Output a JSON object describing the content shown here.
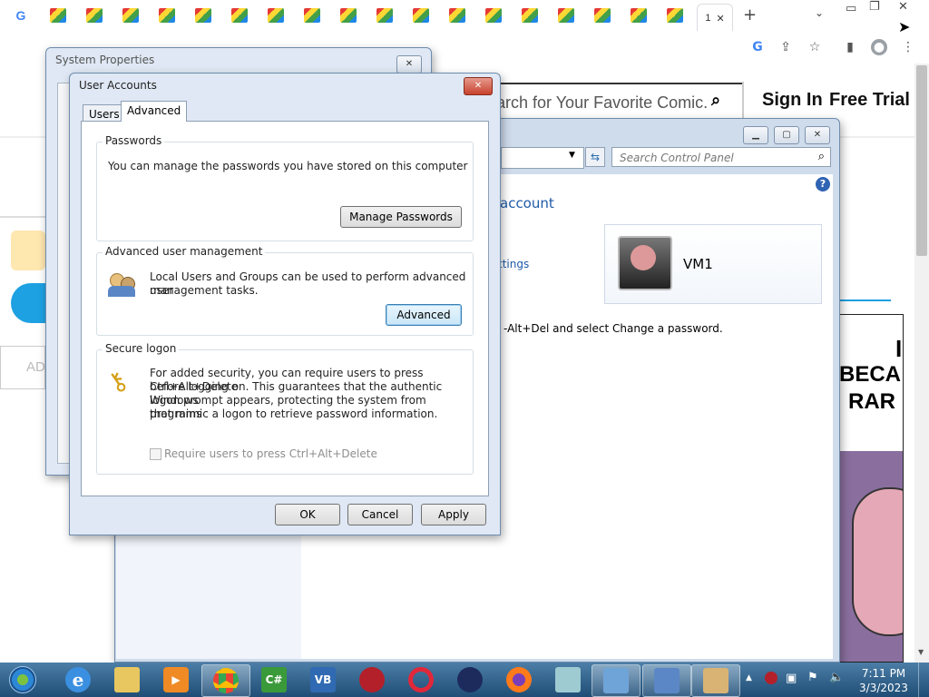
{
  "browser": {
    "active_tab_text": "1",
    "tab_count_icons": 18
  },
  "website": {
    "search_placeholder": "arch for Your Favorite Comic.",
    "sign_in": "Sign In",
    "free_trial": "Free Trial",
    "left_button_text": "AD",
    "comic_text_1": "BECA",
    "comic_text_2": "RAR",
    "comic_text_3": "I"
  },
  "system_properties": {
    "title": "System Properties"
  },
  "control_panel": {
    "search_placeholder": "Search Control Panel",
    "heading_fragment": "account",
    "link_fragment": "ttings",
    "instruction_fragment": "-Alt+Del and select Change a password.",
    "user_name": "VM1"
  },
  "user_accounts": {
    "title": "User Accounts",
    "tabs": [
      "Users",
      "Advanced"
    ],
    "passwords": {
      "label": "Passwords",
      "text": "You can manage the passwords you have stored on this computer",
      "button": "Manage Passwords"
    },
    "advanced_management": {
      "label": "Advanced user management",
      "text_line1": "Local Users and Groups can be used to perform advanced user",
      "text_line2": "management tasks.",
      "button": "Advanced"
    },
    "secure_logon": {
      "label": "Secure logon",
      "line1": "For added security, you can require users to press Ctrl+Alt+Delete",
      "line2": "before logging on. This guarantees that the authentic Windows",
      "line3": "logon prompt appears, protecting the system from programs",
      "line4": "that mimic a logon to retrieve password information.",
      "checkbox_label": "Require users to press Ctrl+Alt+Delete",
      "checkbox_checked": false
    },
    "buttons": {
      "ok": "OK",
      "cancel": "Cancel",
      "apply": "Apply"
    }
  },
  "taskbar": {
    "time": "7:11 PM",
    "date": "3/3/2023"
  },
  "colors": {
    "taskbar": "#2b5f8a",
    "close_button": "#c7422c",
    "link_blue": "#1e5aa8"
  }
}
